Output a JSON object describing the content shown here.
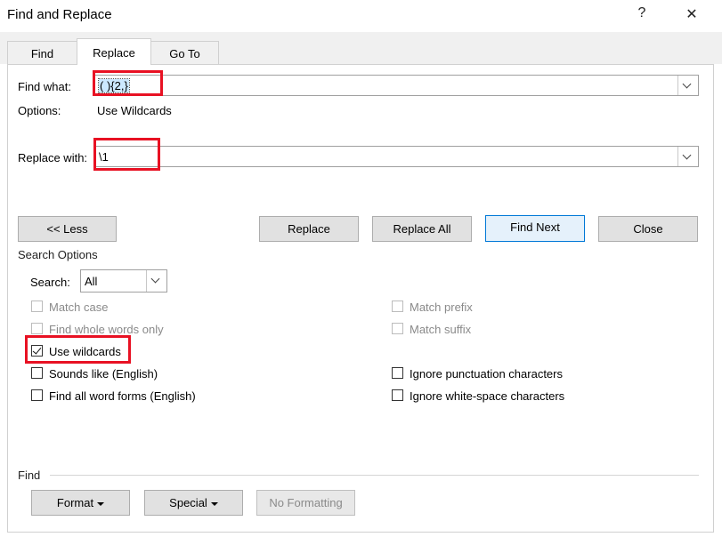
{
  "window": {
    "title": "Find and Replace",
    "help_glyph": "?",
    "close_glyph": "✕"
  },
  "tabs": [
    {
      "label": "Find"
    },
    {
      "label": "Replace"
    },
    {
      "label": "Go To"
    }
  ],
  "find": {
    "label": "Find what:",
    "value": "( ){2,}"
  },
  "options": {
    "label": "Options:",
    "value": "Use Wildcards"
  },
  "replace": {
    "label": "Replace with:",
    "value": "\\1"
  },
  "buttons": {
    "less": "<< Less",
    "replace": "Replace",
    "replace_all": "Replace All",
    "find_next": "Find Next",
    "close": "Close"
  },
  "search_options": {
    "heading": "Search Options",
    "search_label": "Search:",
    "search_value": "All"
  },
  "checkboxes": {
    "match_case": "Match case",
    "whole_words": "Find whole words only",
    "wildcards": "Use wildcards",
    "sounds_like": "Sounds like (English)",
    "word_forms": "Find all word forms (English)",
    "match_prefix": "Match prefix",
    "match_suffix": "Match suffix",
    "ignore_punct": "Ignore punctuation characters",
    "ignore_space": "Ignore white-space characters"
  },
  "find_section": {
    "heading": "Find",
    "format": "Format",
    "special": "Special",
    "no_formatting": "No Formatting"
  }
}
